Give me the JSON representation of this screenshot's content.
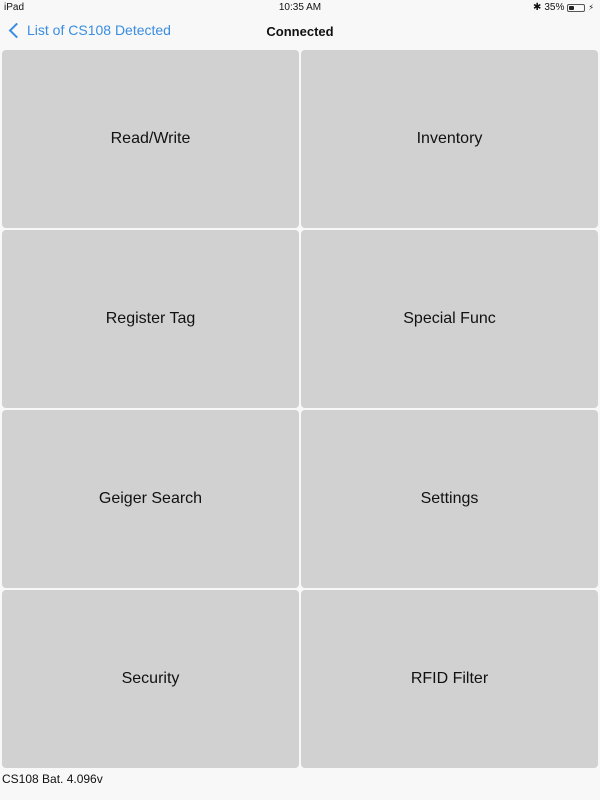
{
  "status_bar": {
    "device": "iPad",
    "time": "10:35 AM",
    "battery_percent": "35%",
    "battery_level": 0.35,
    "bluetooth_icon": "bluetooth-icon"
  },
  "nav": {
    "back_label": "List of CS108 Detected",
    "title": "Connected"
  },
  "tiles": [
    {
      "label": "Read/Write"
    },
    {
      "label": "Inventory"
    },
    {
      "label": "Register Tag"
    },
    {
      "label": "Special Func"
    },
    {
      "label": "Geiger Search"
    },
    {
      "label": "Settings"
    },
    {
      "label": "Security"
    },
    {
      "label": "RFID Filter"
    }
  ],
  "footer": {
    "battery_text": "CS108 Bat. 4.096v"
  }
}
